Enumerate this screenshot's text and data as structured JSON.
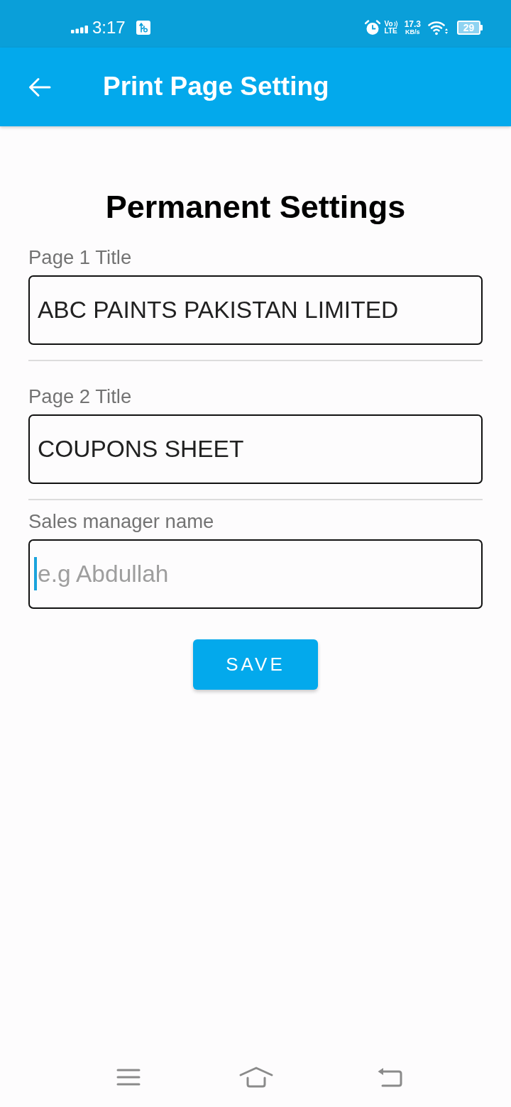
{
  "status_bar": {
    "time": "3:17",
    "network": {
      "top": "Vo",
      "bottom": "LTE"
    },
    "speed": {
      "value": "17.3",
      "unit": "KB/s"
    },
    "battery": "29"
  },
  "app_bar": {
    "title": "Print Page Setting"
  },
  "heading": "Permanent Settings",
  "fields": [
    {
      "label": "Page 1 Title",
      "value": "ABC PAINTS PAKISTAN LIMITED",
      "focused": false
    },
    {
      "label": "Page 2 Title",
      "value": "COUPONS SHEET",
      "focused": false
    },
    {
      "label": "Sales manager name",
      "placeholder": "e.g Abdullah",
      "focused": true
    }
  ],
  "save_button": "SAVE"
}
